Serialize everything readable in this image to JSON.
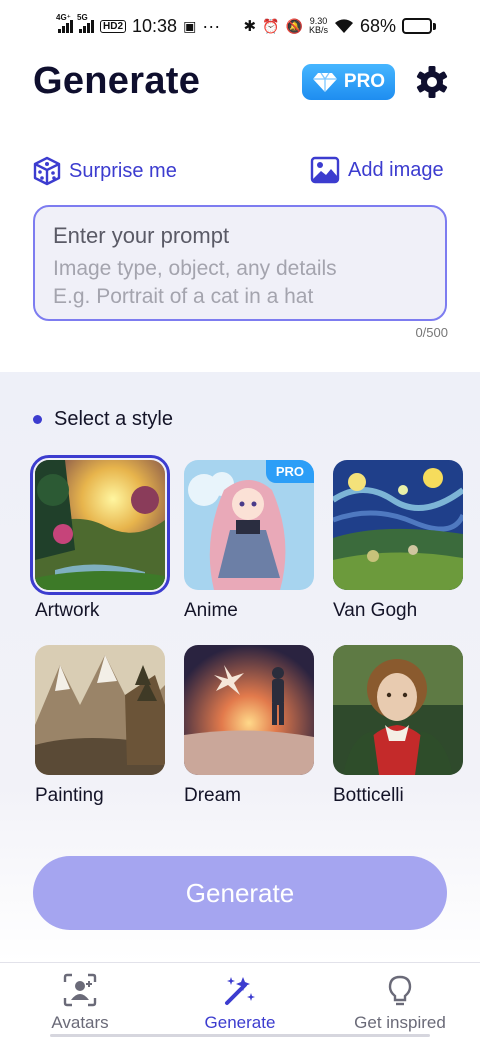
{
  "status_bar": {
    "net1": "4G⁺",
    "net2": "5G",
    "hd": "HD2",
    "time": "10:38",
    "speed_top": "9.30",
    "speed_bottom": "KB/s",
    "battery": "68%",
    "battery_level": 0.68
  },
  "header": {
    "title": "Generate",
    "pro_label": "PRO"
  },
  "prompt": {
    "surprise_label": "Surprise me",
    "add_image_label": "Add image",
    "title": "Enter your prompt",
    "hint1": "Image type, object, any details",
    "hint2": "E.g. Portrait of a cat in a hat",
    "count": "0/500"
  },
  "styles": {
    "section_title": "Select a style",
    "items": [
      {
        "label": "Artwork",
        "selected": true
      },
      {
        "label": "Anime",
        "pro": "PRO"
      },
      {
        "label": "Van Gogh"
      },
      {
        "label": "Painting"
      },
      {
        "label": "Dream"
      },
      {
        "label": "Botticelli"
      }
    ]
  },
  "generate_label": "Generate",
  "nav": {
    "items": [
      {
        "label": "Avatars",
        "icon": "avatar-scan-icon"
      },
      {
        "label": "Generate",
        "icon": "magic-wand-icon",
        "active": true
      },
      {
        "label": "Get inspired",
        "icon": "lightbulb-icon"
      }
    ]
  },
  "colors": {
    "accent": "#3c3ccf",
    "generate_button": "#a5a5f0",
    "pro_badge": "#2c9ef7"
  }
}
